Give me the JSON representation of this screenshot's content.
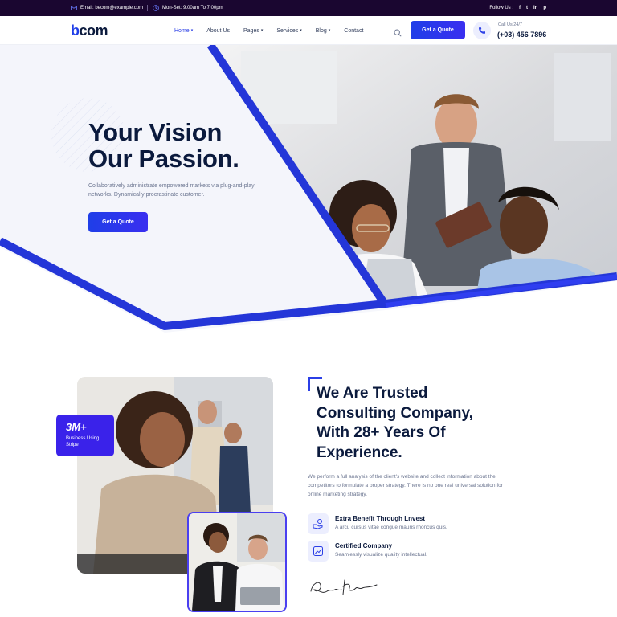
{
  "topbar": {
    "email": "Email: becom@example.com",
    "hours": "Mon-Set: 9.00am To 7.00pm",
    "follow_label": "Follow Us :",
    "social_icons": [
      "facebook-icon",
      "twitter-icon",
      "linkedin-icon",
      "pinterest-icon"
    ],
    "social_glyphs": [
      "f",
      "t",
      "in",
      "p"
    ]
  },
  "nav": {
    "logo_b": "b",
    "logo_rest": "com",
    "items": [
      {
        "label": "Home"
      },
      {
        "label": "About Us"
      },
      {
        "label": "Pages"
      },
      {
        "label": "Services"
      },
      {
        "label": "Blog"
      },
      {
        "label": "Contact"
      }
    ],
    "quote_button": "Get a Quote",
    "call_label": "Call Us 24/7",
    "call_number": "(+03) 456 7896"
  },
  "hero": {
    "title_line1": "Your Vision",
    "title_line2": "Our Passion.",
    "description": "Collaboratively administrate empowered markets via plug-and-play networks. Dynamically procrastinate customer.",
    "button": "Get a Quote"
  },
  "about": {
    "stat_value": "3M+",
    "stat_label": "Business Using Stripe",
    "title": "We Are Trusted Consulting Company, With 28+ Years Of Experience.",
    "description": "We perform a full analysis of the client's website and collect information about the competitors to formulate a proper strategy. There is no one real universal solution for online marketing strategy.",
    "features": [
      {
        "title": "Extra Benefit Through Lnvest",
        "desc": "A arcu cursus vitae congue mauris rhoncus quis."
      },
      {
        "title": "Certified Company",
        "desc": "Seamlessly visualize quality intellectual."
      }
    ]
  },
  "colors": {
    "accent": "#1f3ee8",
    "topbar_bg": "#1a0630",
    "heading": "#0b1a3d",
    "muted": "#6b7590"
  }
}
